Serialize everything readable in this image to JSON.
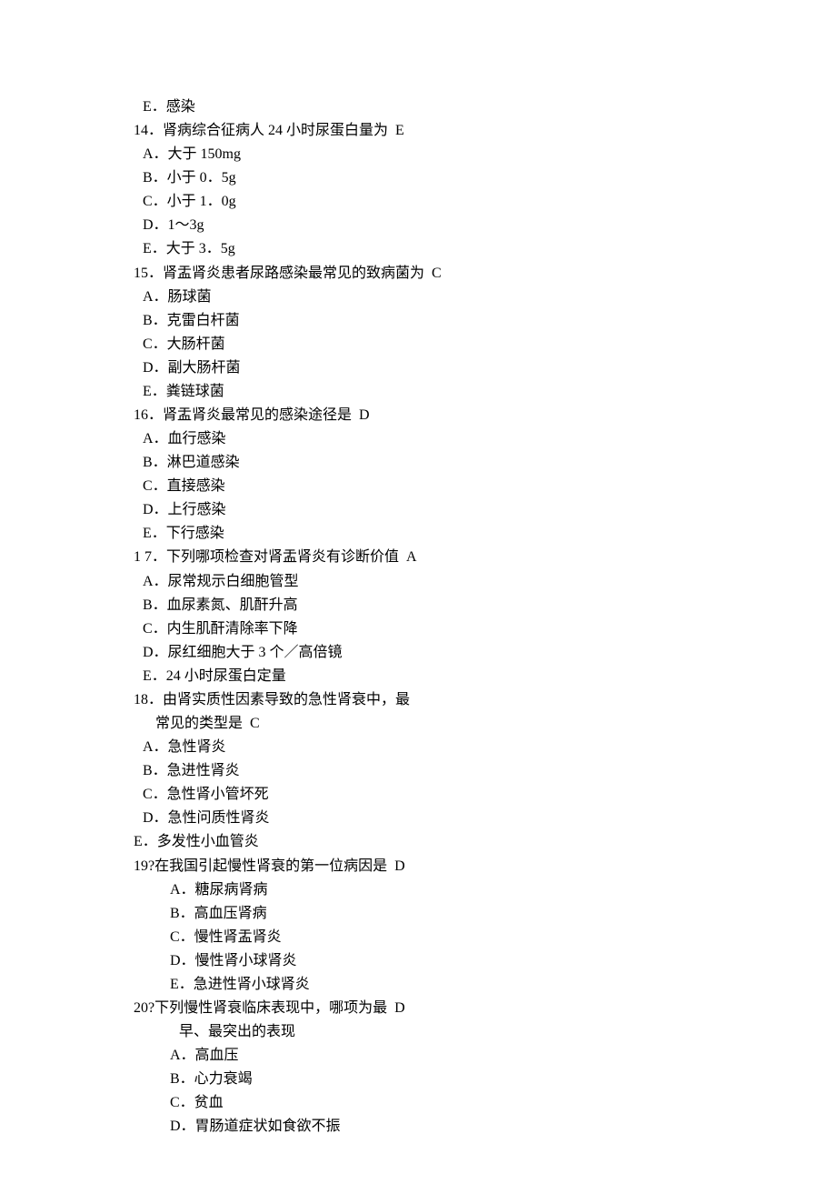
{
  "lines": [
    {
      "indent": "indent-1",
      "text": "E．感染"
    },
    {
      "indent": "indent-0",
      "text": "14．肾病综合征病人 24 小时尿蛋白量为  E"
    },
    {
      "indent": "indent-1",
      "text": "A．大于 150mg"
    },
    {
      "indent": "indent-1",
      "text": "B．小于 0．5g"
    },
    {
      "indent": "indent-1",
      "text": "C．小于 1．0g"
    },
    {
      "indent": "indent-1",
      "text": "D．1～3g"
    },
    {
      "indent": "indent-1",
      "text": "E．大于 3．5g"
    },
    {
      "indent": "indent-0",
      "text": "15．肾盂肾炎患者尿路感染最常见的致病菌为  C"
    },
    {
      "indent": "indent-1",
      "text": "A．肠球菌"
    },
    {
      "indent": "indent-1",
      "text": "B．克雷白杆菌"
    },
    {
      "indent": "indent-1",
      "text": "C．大肠杆菌"
    },
    {
      "indent": "indent-1",
      "text": "D．副大肠杆菌"
    },
    {
      "indent": "indent-1",
      "text": "E．粪链球菌"
    },
    {
      "indent": "indent-0",
      "text": "16．肾盂肾炎最常见的感染途径是  D"
    },
    {
      "indent": "indent-1",
      "text": "A．血行感染"
    },
    {
      "indent": "indent-1",
      "text": "B．淋巴道感染"
    },
    {
      "indent": "indent-1",
      "text": "C．直接感染"
    },
    {
      "indent": "indent-1",
      "text": "D．上行感染"
    },
    {
      "indent": "indent-1",
      "text": "E．下行感染"
    },
    {
      "indent": "indent-0",
      "text": "1 7．下列哪项检查对肾盂肾炎有诊断价值  A"
    },
    {
      "indent": "indent-1",
      "text": "A．尿常规示白细胞管型"
    },
    {
      "indent": "indent-1",
      "text": "B．血尿素氮、肌酐升高"
    },
    {
      "indent": "indent-1",
      "text": "C．内生肌酐清除率下降"
    },
    {
      "indent": "indent-1",
      "text": "D．尿红细胞大于 3 个／高倍镜"
    },
    {
      "indent": "indent-1",
      "text": "E．24 小时尿蛋白定量"
    },
    {
      "indent": "indent-0",
      "text": "18．由肾实质性因素导致的急性肾衰中，最"
    },
    {
      "indent": "indent-2",
      "text": "常见的类型是  C"
    },
    {
      "indent": "indent-1",
      "text": "A．急性肾炎"
    },
    {
      "indent": "indent-1",
      "text": "B．急进性肾炎"
    },
    {
      "indent": "indent-1",
      "text": "C．急性肾小管坏死"
    },
    {
      "indent": "indent-1",
      "text": "D．急性问质性肾炎"
    },
    {
      "indent": "indent-0",
      "text": "E．多发性小血管炎"
    },
    {
      "indent": "indent-0",
      "text": "19?在我国引起慢性肾衰的第一位病因是  D"
    },
    {
      "indent": "indent-3",
      "text": "A．糖尿病肾病"
    },
    {
      "indent": "indent-3",
      "text": "B．高血压肾病"
    },
    {
      "indent": "indent-3",
      "text": "C．慢性肾盂肾炎"
    },
    {
      "indent": "indent-3",
      "text": "D．慢性肾小球肾炎"
    },
    {
      "indent": "indent-3",
      "text": "E．急进性肾小球肾炎"
    },
    {
      "indent": "indent-0",
      "text": "20?下列慢性肾衰临床表现中，哪项为最  D"
    },
    {
      "indent": "indent-4",
      "text": "早、最突出的表现"
    },
    {
      "indent": "indent-3",
      "text": "A．高血压"
    },
    {
      "indent": "indent-3",
      "text": "B．心力衰竭"
    },
    {
      "indent": "indent-3",
      "text": "C．贫血"
    },
    {
      "indent": "indent-3",
      "text": "D．胃肠道症状如食欲不振"
    }
  ]
}
